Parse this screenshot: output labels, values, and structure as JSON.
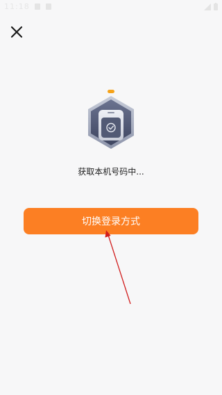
{
  "status_bar": {
    "time": "11:18"
  },
  "icons": {
    "close": "close-icon",
    "logo": "phone-shield-icon",
    "battery": "battery-icon"
  },
  "main": {
    "status_text": "获取本机号码中...",
    "switch_button_label": "切换登录方式"
  },
  "colors": {
    "accent": "#fc7f23",
    "annotation": "#d11d1d",
    "background": "#f7f7f8"
  }
}
